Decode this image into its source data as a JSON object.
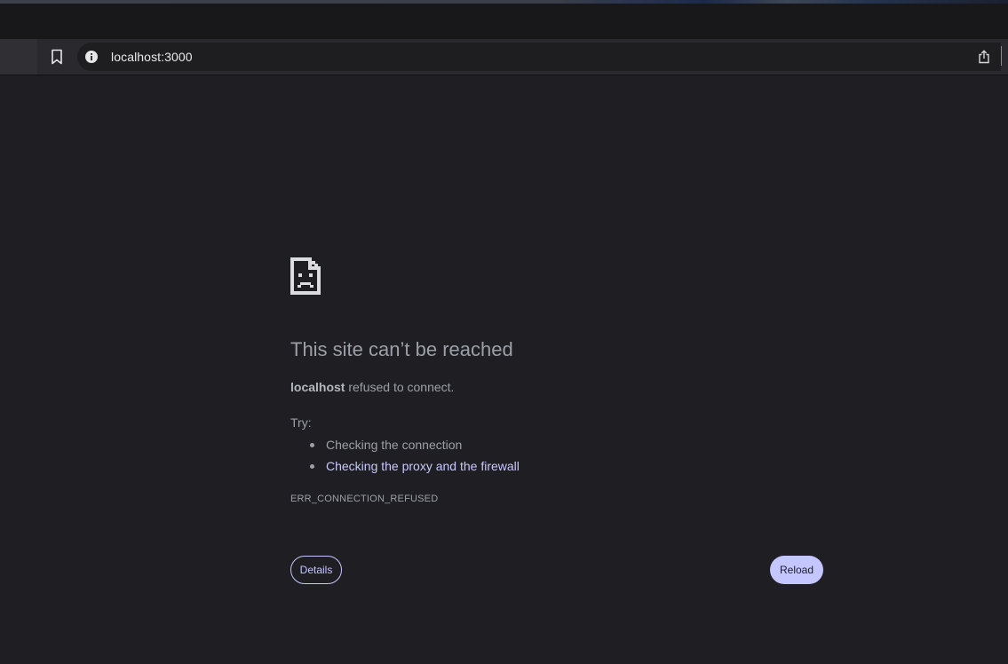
{
  "browser": {
    "address_bar": {
      "url": "localhost:3000",
      "site_info_icon": "info-circle-icon",
      "share_icon": "share-icon"
    },
    "bookmark_icon": "bookmark-icon"
  },
  "error_page": {
    "icon": "sad-page-icon",
    "title": "This site can’t be reached",
    "host": "localhost",
    "summary_suffix": " refused to connect.",
    "try_label": "Try:",
    "suggestions": [
      {
        "text": "Checking the connection",
        "link": false
      },
      {
        "text": "Checking the proxy and the firewall",
        "link": true
      }
    ],
    "error_code": "ERR_CONNECTION_REFUSED",
    "details_label": "Details",
    "reload_label": "Reload"
  },
  "colors": {
    "page_background": "#1f1f23",
    "text_secondary": "#9aa0a6",
    "accent": "#c4c6ff",
    "link": "#c8c8ff"
  }
}
